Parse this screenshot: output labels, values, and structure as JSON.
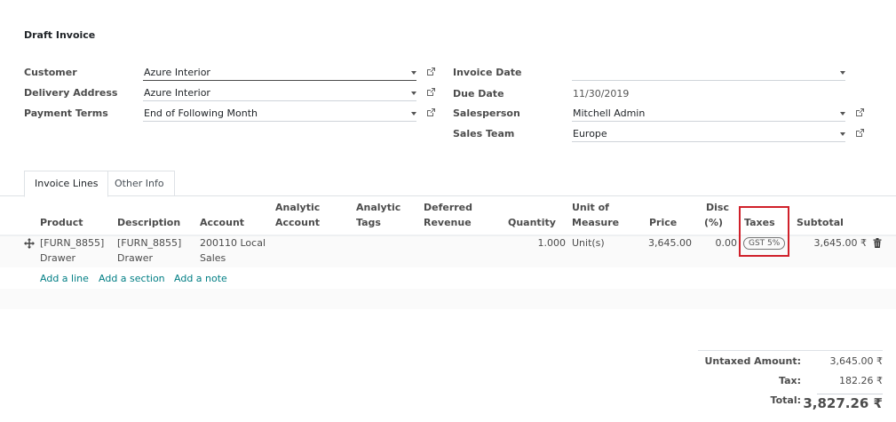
{
  "page": {
    "title": "Draft Invoice"
  },
  "form": {
    "customer": {
      "label": "Customer",
      "value": "Azure Interior"
    },
    "delivery_address": {
      "label": "Delivery Address",
      "value": "Azure Interior"
    },
    "payment_terms": {
      "label": "Payment Terms",
      "value": "End of Following Month"
    },
    "invoice_date": {
      "label": "Invoice Date",
      "value": ""
    },
    "due_date": {
      "label": "Due Date",
      "value": "11/30/2019"
    },
    "salesperson": {
      "label": "Salesperson",
      "value": "Mitchell Admin"
    },
    "sales_team": {
      "label": "Sales Team",
      "value": "Europe"
    }
  },
  "tabs": [
    {
      "label": "Invoice Lines",
      "active": true
    },
    {
      "label": "Other Info",
      "active": false
    }
  ],
  "table": {
    "columns": {
      "product": "Product",
      "description": "Description",
      "account": "Account",
      "analytic_account_1": "Analytic",
      "analytic_account_2": "Account",
      "analytic_tags_1": "Analytic",
      "analytic_tags_2": "Tags",
      "deferred_revenue_1": "Deferred",
      "deferred_revenue_2": "Revenue",
      "quantity": "Quantity",
      "uom_1": "Unit of",
      "uom_2": "Measure",
      "price": "Price",
      "disc_1": "Disc",
      "disc_2": "(%)",
      "taxes": "Taxes",
      "subtotal": "Subtotal"
    },
    "rows": [
      {
        "product_1": "[FURN_8855]",
        "product_2": "Drawer",
        "description_1": "[FURN_8855]",
        "description_2": "Drawer",
        "account_1": "200110 Local",
        "account_2": "Sales",
        "quantity": "1.000",
        "uom": "Unit(s)",
        "price": "3,645.00",
        "discount": "0.00",
        "tax": "GST 5%",
        "subtotal": "3,645.00 ₹"
      }
    ],
    "add_links": {
      "line": "Add a line",
      "section": "Add a section",
      "note": "Add a note"
    }
  },
  "totals": {
    "untaxed_label": "Untaxed Amount:",
    "untaxed_value": "3,645.00 ₹",
    "tax_label": "Tax:",
    "tax_value": "182.26 ₹",
    "total_label": "Total:",
    "total_value": "3,827.26 ₹"
  },
  "colors": {
    "link": "#017e84",
    "highlight": "#d0202a"
  },
  "icons": {
    "external_link": "external-link-icon",
    "drag_handle": "drag-handle-icon",
    "delete": "trash-icon"
  }
}
